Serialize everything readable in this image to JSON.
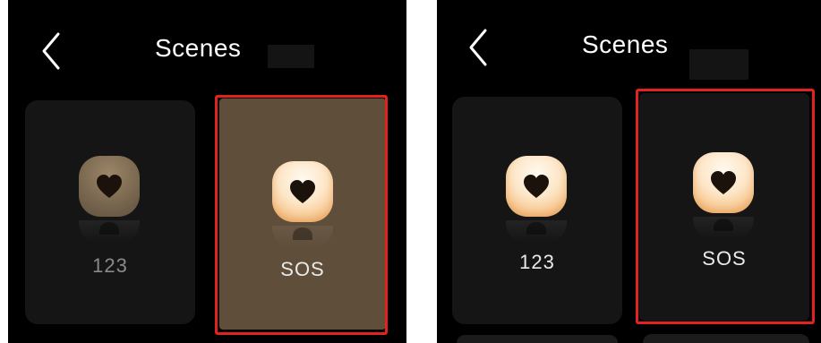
{
  "screens": [
    {
      "header": {
        "title": "Scenes",
        "back_icon": "chevron-left-icon"
      },
      "tiles": [
        {
          "label": "123",
          "icon": "heart-icon",
          "state": "dim"
        },
        {
          "label": "SOS",
          "icon": "heart-icon",
          "state": "selected"
        }
      ]
    },
    {
      "header": {
        "title": "Scenes",
        "back_icon": "chevron-left-icon"
      },
      "tiles": [
        {
          "label": "123",
          "icon": "heart-icon",
          "state": "normal"
        },
        {
          "label": "SOS",
          "icon": "heart-icon",
          "state": "selected"
        }
      ]
    }
  ],
  "colors": {
    "background": "#000000",
    "tile": "#151515",
    "selected_tile_left": "#5f4e3a",
    "highlight_frame": "#e1221f",
    "icon_gradient_start": "#fffaf0",
    "icon_gradient_end": "#efac66"
  }
}
